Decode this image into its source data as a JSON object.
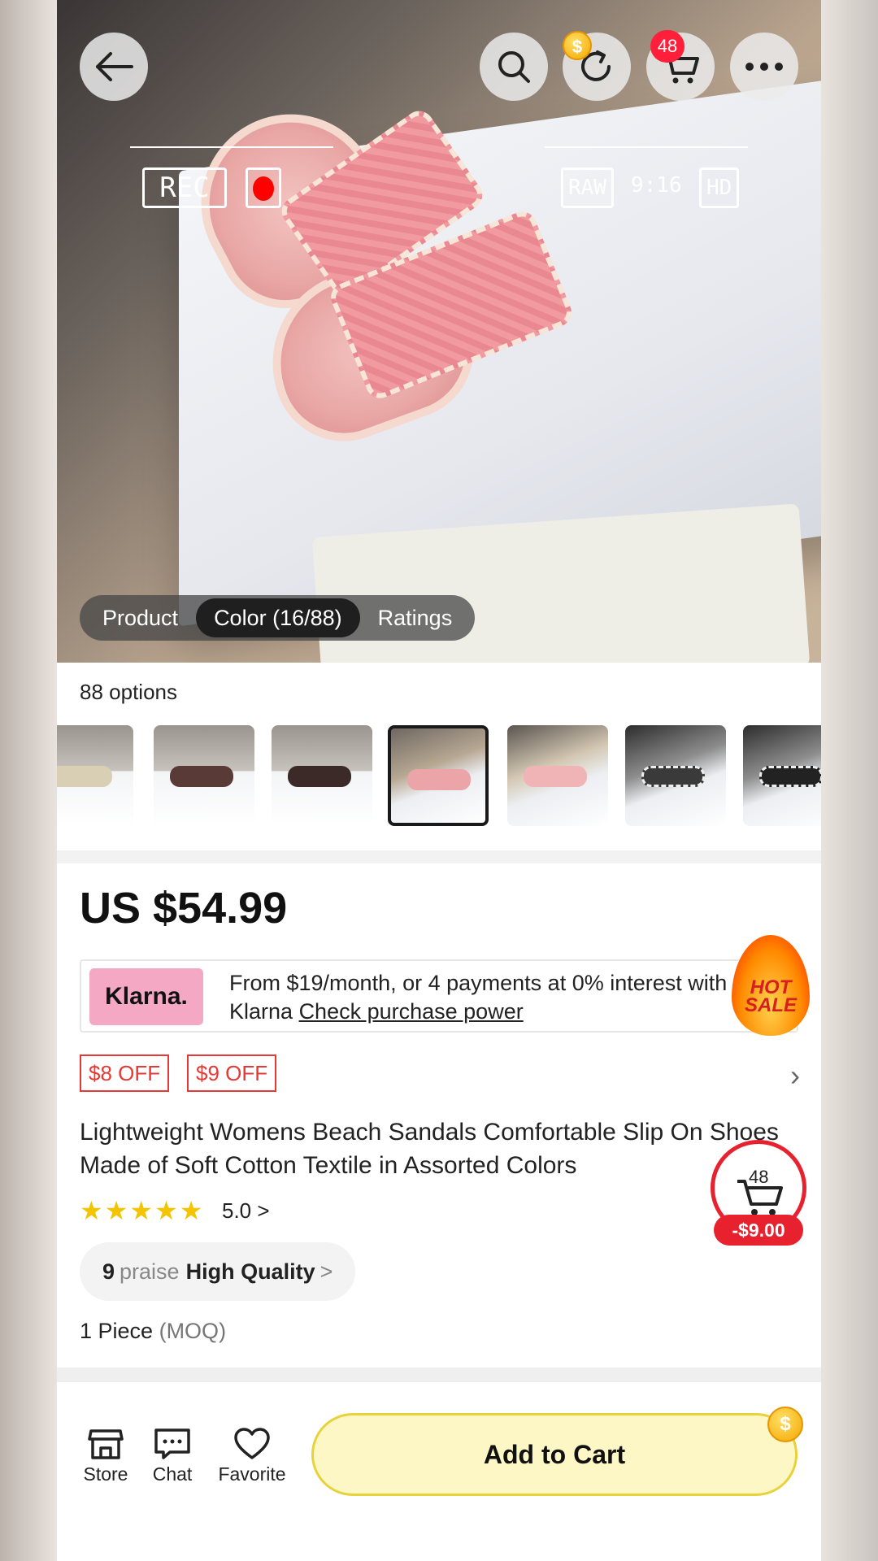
{
  "hero": {
    "rec_label": "REC",
    "raw_label": "RAW",
    "ratio_label": "9:16",
    "hd_label": "HD",
    "cart_badge": "48",
    "coin_symbol": "$",
    "tabs": [
      {
        "label": "Product"
      },
      {
        "label": "Color (16/88)"
      },
      {
        "label": "Ratings"
      }
    ]
  },
  "options": {
    "count_label": "88 options"
  },
  "price": "US $54.99",
  "klarna": {
    "logo": "Klarna.",
    "line1": "From $19/month, or 4 payments at 0% interest with",
    "line2_prefix": "Klarna ",
    "line2_link": "Check purchase power"
  },
  "hot_sale": {
    "line1": "HOT",
    "line2": "SALE"
  },
  "coupons": [
    "$8 OFF",
    "$9 OFF"
  ],
  "product_title": "Lightweight Womens Beach Sandals Comfortable Slip On Shoes Made of Soft Cotton Textile in Assorted Colors",
  "rating": {
    "stars": "★★★★★",
    "value_label": "5.0 >",
    "value": 5.0
  },
  "floating_cart": {
    "count": "48",
    "discount": "-$9.00"
  },
  "praise": {
    "count": "9",
    "word": "praise",
    "tag": "High Quality",
    "arrow": ">"
  },
  "moq": {
    "qty": "1 Piece",
    "label": "(MOQ)"
  },
  "bottom_bar": {
    "store": "Store",
    "chat": "Chat",
    "favorite": "Favorite",
    "add_to_cart": "Add to Cart"
  },
  "colors": {
    "accent_red": "#e8212f",
    "klarna_pink": "#f5a8c4",
    "add_to_cart_bg": "#fdf7c5",
    "star_yellow": "#f5c400"
  }
}
